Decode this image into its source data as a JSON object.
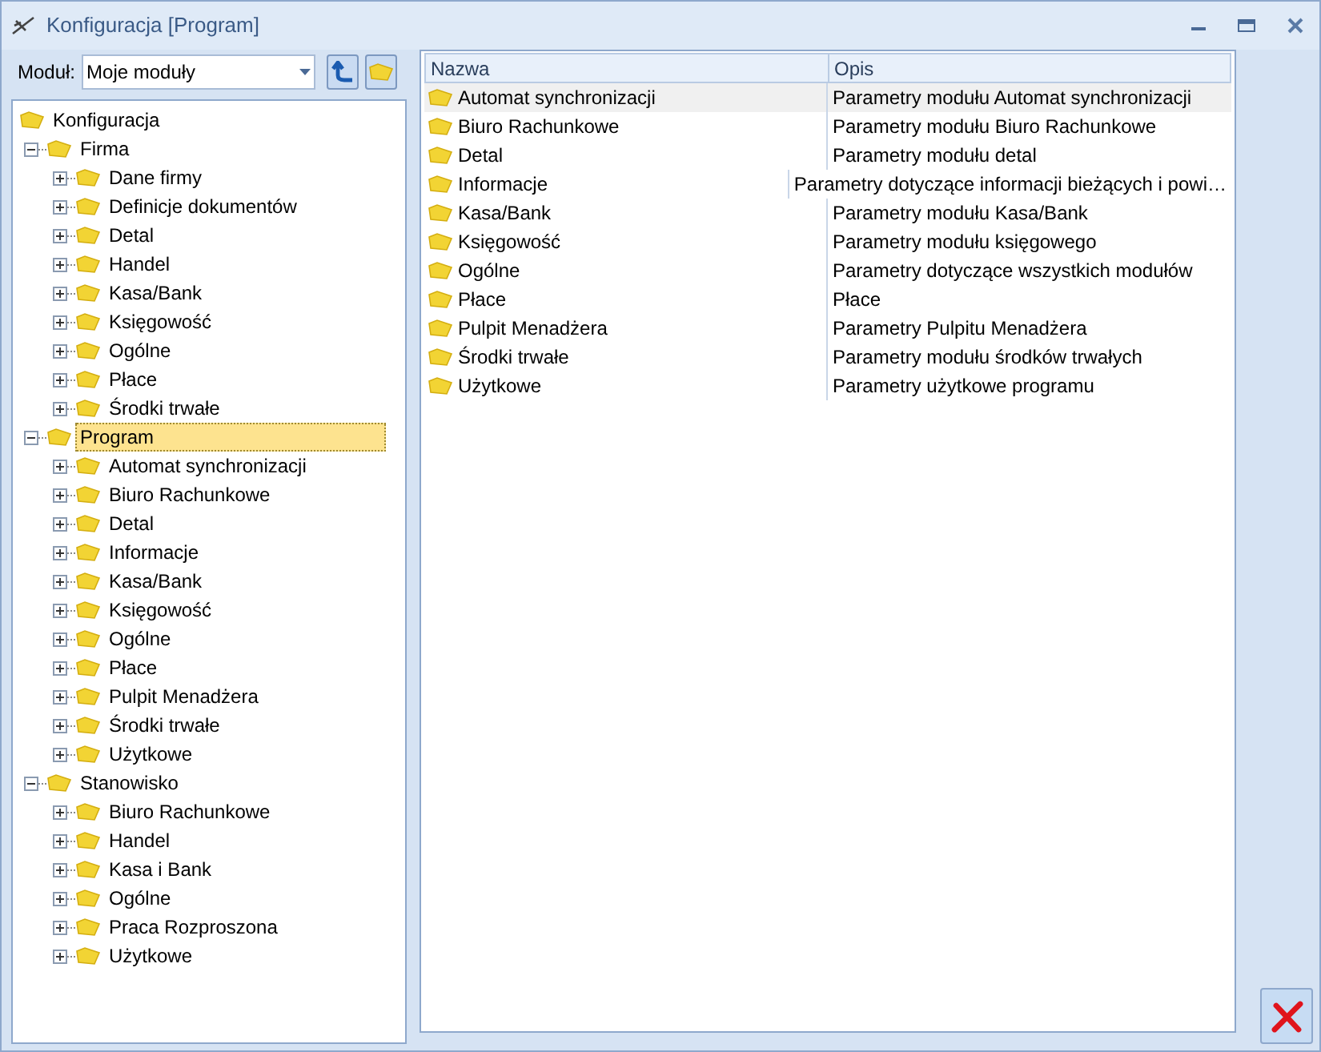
{
  "window": {
    "title": "Konfiguracja [Program]"
  },
  "toolbar": {
    "module_label": "Moduł:",
    "module_value": "Moje moduły"
  },
  "tree": [
    {
      "label": "Konfiguracja",
      "selected": false,
      "children": [
        {
          "label": "Firma",
          "expanded": true,
          "selected": false,
          "children": [
            {
              "label": "Dane firmy",
              "expanded": false,
              "selected": false
            },
            {
              "label": "Definicje dokumentów",
              "expanded": false,
              "selected": false
            },
            {
              "label": "Detal",
              "expanded": false,
              "selected": false
            },
            {
              "label": "Handel",
              "expanded": false,
              "selected": false
            },
            {
              "label": "Kasa/Bank",
              "expanded": false,
              "selected": false
            },
            {
              "label": "Księgowość",
              "expanded": false,
              "selected": false
            },
            {
              "label": "Ogólne",
              "expanded": false,
              "selected": false
            },
            {
              "label": "Płace",
              "expanded": false,
              "selected": false
            },
            {
              "label": "Środki trwałe",
              "expanded": false,
              "selected": false
            }
          ]
        },
        {
          "label": "Program",
          "expanded": true,
          "selected": true,
          "children": [
            {
              "label": "Automat synchronizacji",
              "expanded": false,
              "selected": false
            },
            {
              "label": "Biuro Rachunkowe",
              "expanded": false,
              "selected": false
            },
            {
              "label": "Detal",
              "expanded": false,
              "selected": false
            },
            {
              "label": "Informacje",
              "expanded": false,
              "selected": false
            },
            {
              "label": "Kasa/Bank",
              "expanded": false,
              "selected": false
            },
            {
              "label": "Księgowość",
              "expanded": false,
              "selected": false
            },
            {
              "label": "Ogólne",
              "expanded": false,
              "selected": false
            },
            {
              "label": "Płace",
              "expanded": false,
              "selected": false
            },
            {
              "label": "Pulpit Menadżera",
              "expanded": false,
              "selected": false
            },
            {
              "label": "Środki trwałe",
              "expanded": false,
              "selected": false
            },
            {
              "label": "Użytkowe",
              "expanded": false,
              "selected": false
            }
          ]
        },
        {
          "label": "Stanowisko",
          "expanded": true,
          "selected": false,
          "children": [
            {
              "label": "Biuro Rachunkowe",
              "expanded": false,
              "selected": false
            },
            {
              "label": "Handel",
              "expanded": false,
              "selected": false
            },
            {
              "label": "Kasa i Bank",
              "expanded": false,
              "selected": false
            },
            {
              "label": "Ogólne",
              "expanded": false,
              "selected": false
            },
            {
              "label": "Praca Rozproszona",
              "expanded": false,
              "selected": false
            },
            {
              "label": "Użytkowe",
              "expanded": false,
              "selected": false
            }
          ]
        }
      ]
    }
  ],
  "table": {
    "columns": [
      "Nazwa",
      "Opis"
    ],
    "rows": [
      {
        "name": "Automat synchronizacji",
        "description": "Parametry modułu Automat synchronizacji",
        "selected": true
      },
      {
        "name": "Biuro Rachunkowe",
        "description": "Parametry modułu Biuro Rachunkowe",
        "selected": false
      },
      {
        "name": "Detal",
        "description": "Parametry modułu detal",
        "selected": false
      },
      {
        "name": "Informacje",
        "description": "Parametry dotyczące informacji bieżących i powi…",
        "selected": false
      },
      {
        "name": "Kasa/Bank",
        "description": "Parametry modułu Kasa/Bank",
        "selected": false
      },
      {
        "name": "Księgowość",
        "description": "Parametry modułu księgowego",
        "selected": false
      },
      {
        "name": "Ogólne",
        "description": "Parametry dotyczące wszystkich modułów",
        "selected": false
      },
      {
        "name": "Płace",
        "description": "Płace",
        "selected": false
      },
      {
        "name": "Pulpit Menadżera",
        "description": "Parametry Pulpitu Menadżera",
        "selected": false
      },
      {
        "name": "Środki trwałe",
        "description": "Parametry modułu środków trwałych",
        "selected": false
      },
      {
        "name": "Użytkowe",
        "description": "Parametry użytkowe programu",
        "selected": false
      }
    ]
  }
}
